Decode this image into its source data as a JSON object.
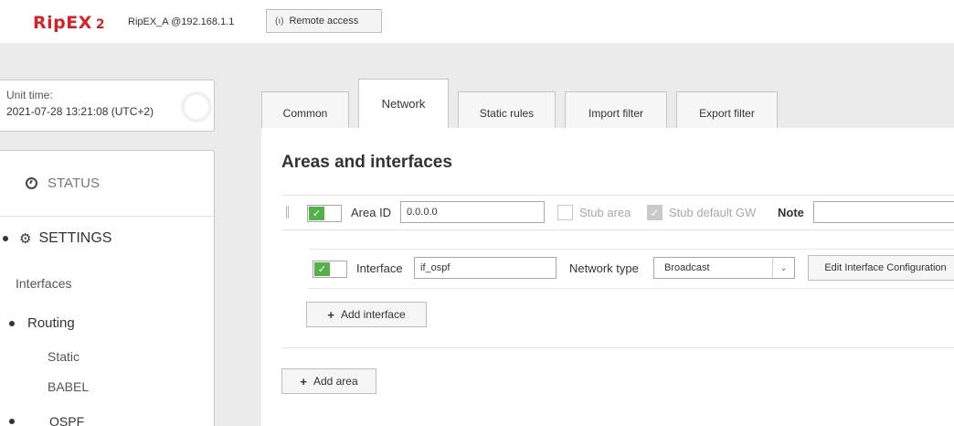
{
  "header": {
    "logo_text": "RipEX",
    "logo_num": "2",
    "device": "RipEX_A @192.168.1.1",
    "remote_access_label": "Remote access",
    "remote_icon": "antenna-icon"
  },
  "unit_time": {
    "label": "Unit time:",
    "value": "2021-07-28 13:21:08 (UTC+2)"
  },
  "menu": {
    "status": "STATUS",
    "settings": "SETTINGS",
    "interfaces": "Interfaces",
    "routing": "Routing",
    "static": "Static",
    "babel": "BABEL",
    "ospf": "OSPF"
  },
  "tabs": [
    {
      "label": "Common",
      "active": false
    },
    {
      "label": "Network",
      "active": true
    },
    {
      "label": "Static rules",
      "active": false
    },
    {
      "label": "Import filter",
      "active": false
    },
    {
      "label": "Export filter",
      "active": false
    }
  ],
  "section_title": "Areas and interfaces",
  "area": {
    "enabled": true,
    "area_id_label": "Area ID",
    "area_id_value": "0.0.0.0",
    "stub_area_label": "Stub area",
    "stub_area_checked": false,
    "stub_default_gw_label": "Stub default GW",
    "stub_default_gw_checked": true,
    "note_label": "Note",
    "note_value": ""
  },
  "interface": {
    "enabled": true,
    "interface_label": "Interface",
    "interface_value": "if_ospf",
    "network_type_label": "Network type",
    "network_type_value": "Broadcast",
    "edit_config_label": "Edit Interface Configuration"
  },
  "add_interface_label": "Add interface",
  "add_area_label": "Add area",
  "colors": {
    "brand_red": "#d2232a",
    "toggle_green": "#55b04a"
  }
}
